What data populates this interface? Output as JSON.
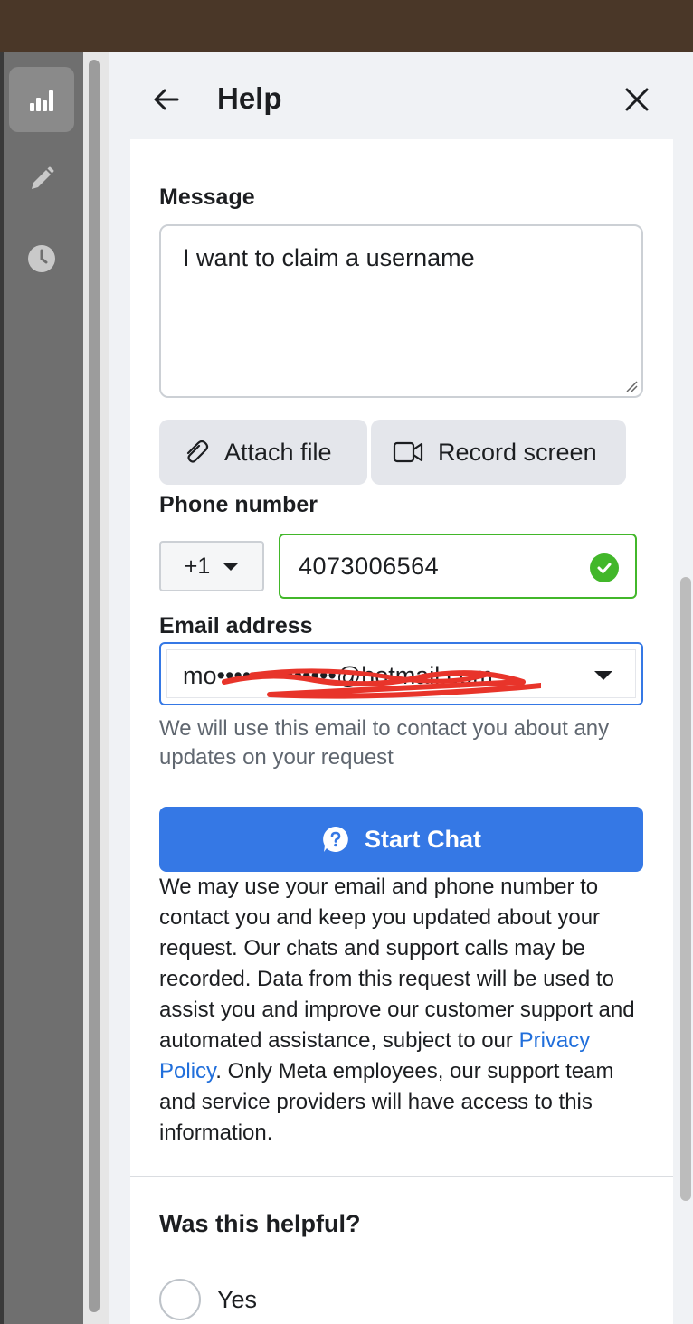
{
  "header": {
    "title": "Help"
  },
  "form": {
    "message_label": "Message",
    "message_value": "I want to claim a username",
    "attach_label": "Attach file",
    "record_label": "Record screen",
    "phone_label": "Phone number",
    "country_code": "+1",
    "phone_value": "4073006564",
    "email_label": "Email address",
    "email_value": "mo••••••••••••••@hotmail.com",
    "email_helper": "We will use this email to contact you about any updates on your request",
    "start_chat_label": "Start Chat"
  },
  "legal": {
    "text_before_link": "We may use your email and phone number to contact you and keep you updated about your request. Our chats and support calls may be recorded. Data from this request will be used to assist you and improve our customer support and automated assistance, subject to our ",
    "link_text": "Privacy Policy",
    "text_after_link": ". Only Meta employees, our support team and service providers will have access to this information."
  },
  "feedback": {
    "question": "Was this helpful?",
    "options": [
      "Yes"
    ]
  },
  "icons": {
    "rail": [
      "bar-chart-icon",
      "pencil-icon",
      "clock-icon"
    ],
    "back": "arrow-left-icon",
    "close": "close-icon",
    "attach": "paperclip-icon",
    "record": "video-camera-icon",
    "check": "check-circle-icon",
    "chat": "messenger-help-icon"
  },
  "colors": {
    "primary": "#3578e5",
    "success": "#42b72a",
    "link": "#216fdb",
    "redaction": "#e8342a"
  }
}
